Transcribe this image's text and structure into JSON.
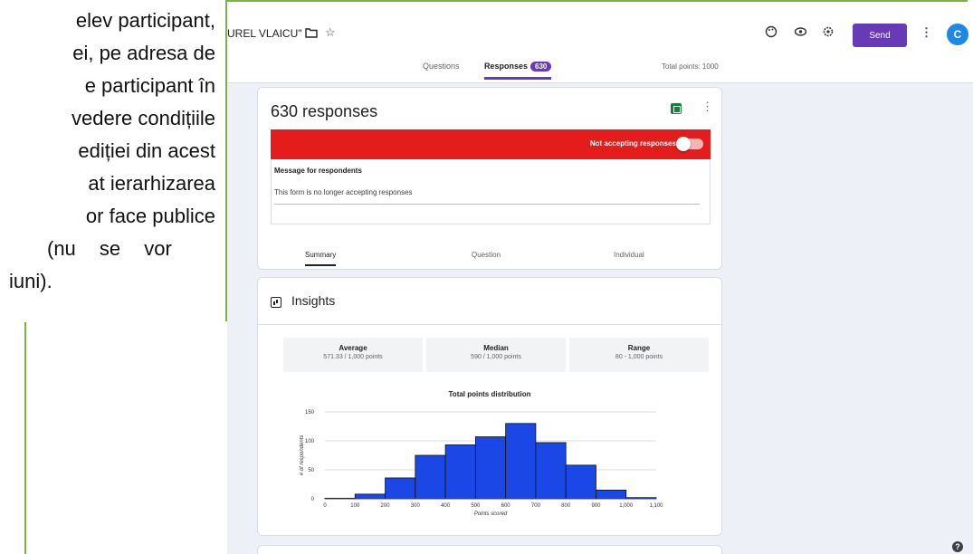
{
  "document_text": {
    "lines": [
      "elev participant,",
      "ei, pe adresa de",
      "e participant în",
      "vedere condițiile",
      "ediției din acest",
      "at ierarhizarea",
      "or face publice",
      "(nu se vor",
      "iuni)."
    ]
  },
  "header": {
    "form_title": "UREL VLAICU\"",
    "send_label": "Send",
    "avatar_letter": "C",
    "tabs": [
      {
        "label": "Questions"
      },
      {
        "label": "Responses",
        "badge": "630"
      }
    ],
    "total_points": "Total points: 1000",
    "accent_color": "#673ab7"
  },
  "responses_card": {
    "count_label": "630 responses",
    "status_label": "Not accepting responses",
    "accepting": false,
    "message_label": "Message for respondents",
    "message_text": "This form is no longer accepting responses",
    "sub_tabs": [
      "Summary",
      "Question",
      "Individual"
    ],
    "active_sub_tab": "Summary"
  },
  "insights": {
    "title": "Insights",
    "stats": [
      {
        "label": "Average",
        "value": "571.33 / 1,000 points"
      },
      {
        "label": "Median",
        "value": "590 / 1,000 points"
      },
      {
        "label": "Range",
        "value": "80 - 1,000 points"
      }
    ]
  },
  "chart_data": {
    "type": "bar",
    "title": "Total points distribution",
    "xlabel": "Points scored",
    "ylabel": "# of respondents",
    "x_ticks": [
      "0",
      "100",
      "200",
      "300",
      "400",
      "500",
      "600",
      "700",
      "800",
      "900",
      "1,000",
      "1,100"
    ],
    "y_ticks": [
      0,
      50,
      100,
      150
    ],
    "ylim": [
      0,
      150
    ],
    "xlim": [
      0,
      1100
    ],
    "bins": [
      {
        "start": 0,
        "end": 100,
        "value": 1
      },
      {
        "start": 100,
        "end": 200,
        "value": 8
      },
      {
        "start": 200,
        "end": 300,
        "value": 36
      },
      {
        "start": 300,
        "end": 400,
        "value": 75
      },
      {
        "start": 400,
        "end": 500,
        "value": 93
      },
      {
        "start": 500,
        "end": 600,
        "value": 107
      },
      {
        "start": 600,
        "end": 700,
        "value": 130
      },
      {
        "start": 700,
        "end": 800,
        "value": 97
      },
      {
        "start": 800,
        "end": 900,
        "value": 58
      },
      {
        "start": 900,
        "end": 1000,
        "value": 15
      },
      {
        "start": 1000,
        "end": 1100,
        "value": 2
      }
    ],
    "bar_color": "#1a47e6",
    "grid": true
  }
}
